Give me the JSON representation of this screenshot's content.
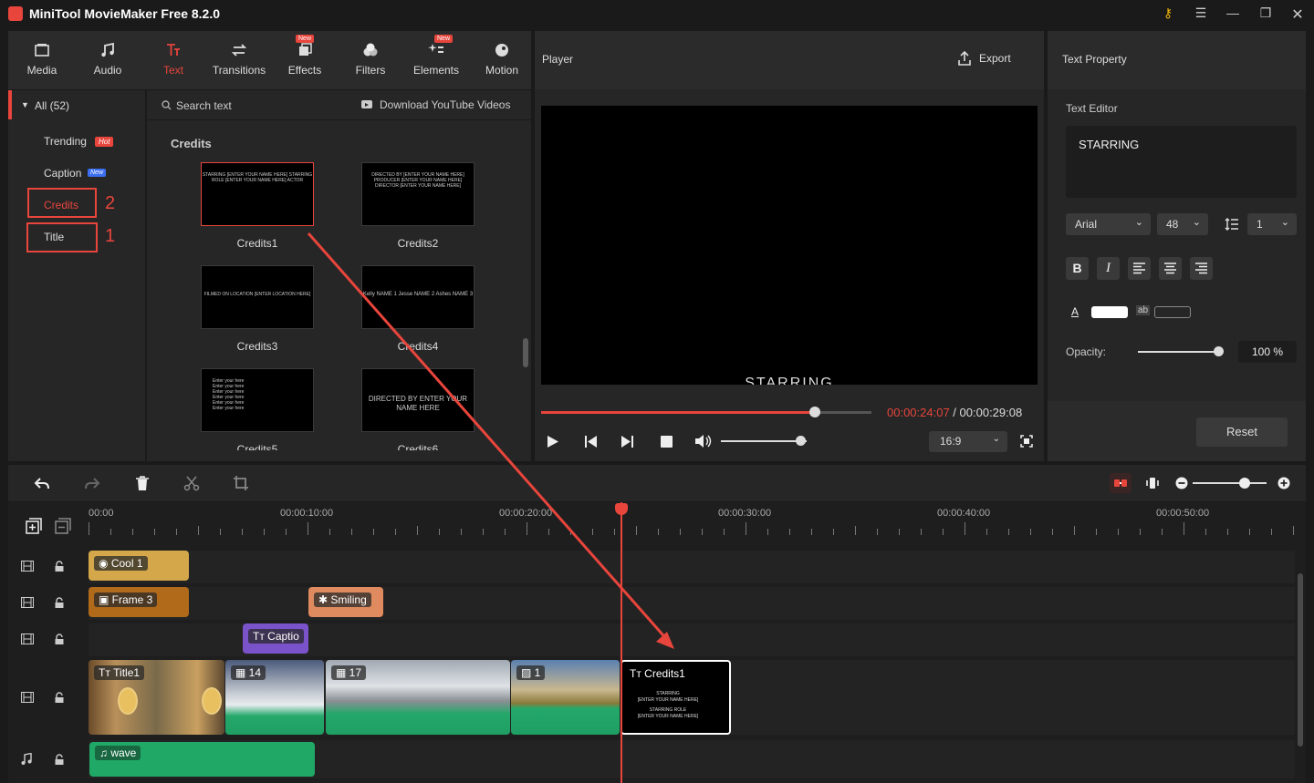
{
  "app": {
    "title": "MiniTool MovieMaker Free 8.2.0"
  },
  "toolbar": {
    "tabs": [
      {
        "label": "Media",
        "icon": "media-icon"
      },
      {
        "label": "Audio",
        "icon": "audio-icon"
      },
      {
        "label": "Text",
        "icon": "text-icon",
        "active": true
      },
      {
        "label": "Transitions",
        "icon": "transitions-icon"
      },
      {
        "label": "Effects",
        "icon": "effects-icon",
        "badge": "New"
      },
      {
        "label": "Filters",
        "icon": "filters-icon"
      },
      {
        "label": "Elements",
        "icon": "elements-icon",
        "badge": "New"
      },
      {
        "label": "Motion",
        "icon": "motion-icon"
      }
    ]
  },
  "categories": {
    "all_label": "All (52)",
    "items": [
      {
        "label": "Trending",
        "badge": "Hot"
      },
      {
        "label": "Caption",
        "badge": "New"
      },
      {
        "label": "Credits",
        "annotation": "2"
      },
      {
        "label": "Title",
        "annotation": "1"
      }
    ]
  },
  "library": {
    "search_placeholder": "Search text",
    "download_label": "Download YouTube Videos",
    "section_title": "Credits",
    "items": [
      {
        "name": "Credits1",
        "preview": "STARRING [ENTER YOUR NAME HERE] STARRING ROLE [ENTER YOUR NAME HERE] ACTOR"
      },
      {
        "name": "Credits2",
        "preview": "DIRECTED BY [ENTER YOUR NAME HERE] PRODUCER [ENTER YOUR NAME HERE] DIRECTOR [ENTER YOUR NAME HERE]"
      },
      {
        "name": "Credits3",
        "preview": "FILMED ON LOCATION [ENTER LOCATION HERE]"
      },
      {
        "name": "Credits4",
        "preview": "Kelly NAME 1 Jesse NAME 2 Ashes NAME 3"
      },
      {
        "name": "Credits5",
        "preview": "Enter your here Enter your here Enter your here Enter your here Enter your here Enter your here"
      },
      {
        "name": "Credits6",
        "preview": "DIRECTED BY ENTER YOUR NAME HERE"
      }
    ]
  },
  "player": {
    "title": "Player",
    "export_label": "Export",
    "overlay_text": "STARRING",
    "current_time": "00:00:24:07",
    "separator": " / ",
    "total_time": "00:00:29:08",
    "progress": 0.83,
    "volume": 0.93,
    "aspect": "16:9"
  },
  "text_property": {
    "title": "Text Property",
    "editor_label": "Text Editor",
    "editor_value": "STARRING",
    "font": "Arial",
    "size": "48",
    "line_spacing": "1",
    "opacity_label": "Opacity:",
    "opacity_value": "100 %",
    "opacity": 1.0,
    "reset_label": "Reset",
    "text_color": "#ffffff"
  },
  "timeline": {
    "zoom": 0.7,
    "ruler": [
      "00:00",
      "00:00:10:00",
      "00:00:20:00",
      "00:00:30:00",
      "00:00:40:00",
      "00:00:50:00"
    ],
    "clips": {
      "cool": "Cool 1",
      "frame": "Frame 3",
      "smiling": "Smiling",
      "caption": "Captio",
      "title": "Title1",
      "v14": "14",
      "v17": "17",
      "v1": "1",
      "credits": "Credits1",
      "credits_line1": "STARRING",
      "credits_line2": "[ENTER YOUR NAME HERE]",
      "credits_line3": "STARRING ROLE",
      "credits_line4": "[ENTER YOUR NAME HERE]",
      "audio": "wave"
    }
  },
  "colors": {
    "accent": "#e8453c",
    "panel": "#262626",
    "background": "#1a1a1a"
  }
}
